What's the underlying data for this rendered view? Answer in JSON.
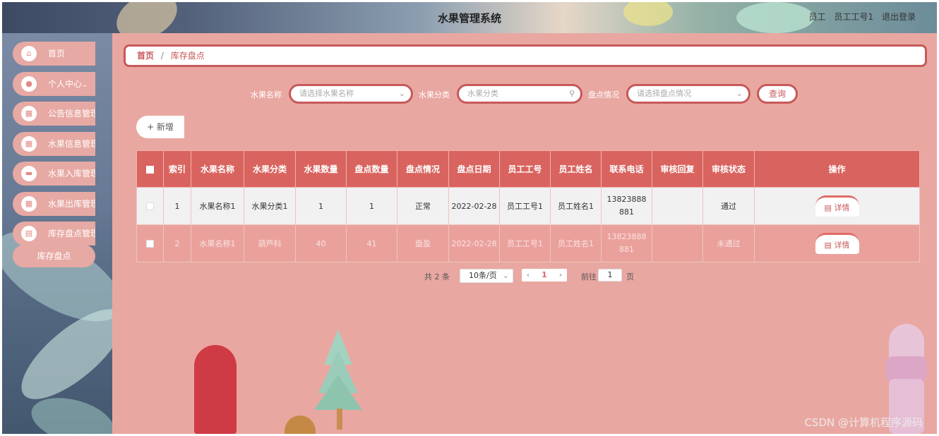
{
  "header": {
    "title": "水果管理系统",
    "role": "员工",
    "user": "员工工号1",
    "logout": "退出登录"
  },
  "sidebar": {
    "items": [
      {
        "label": "首页",
        "icon": "home-icon"
      },
      {
        "label": "个人中心",
        "icon": "user-icon",
        "caret": "⌄"
      },
      {
        "label": "公告信息管理",
        "icon": "grid-icon"
      },
      {
        "label": "水果信息管理",
        "icon": "grid-icon"
      },
      {
        "label": "水果入库管理",
        "icon": "monitor-icon"
      },
      {
        "label": "水果出库管理",
        "icon": "grid-icon"
      },
      {
        "label": "库存盘点管理",
        "icon": "document-icon"
      }
    ],
    "subitem": "库存盘点"
  },
  "breadcrumb": {
    "home": "首页",
    "separator": "/",
    "current": "库存盘点"
  },
  "filters": {
    "name_label": "水果名称",
    "name_placeholder": "请选择水果名称",
    "category_label": "水果分类",
    "category_placeholder": "水果分类",
    "status_label": "盘点情况",
    "status_placeholder": "请选择盘点情况",
    "query_button": "查询"
  },
  "toolbar": {
    "add_button": "+ 新增"
  },
  "table": {
    "headers": [
      "索引",
      "水果名称",
      "水果分类",
      "水果数量",
      "盘点数量",
      "盘点情况",
      "盘点日期",
      "员工工号",
      "员工姓名",
      "联系电话",
      "审核回复",
      "审核状态",
      "操作"
    ],
    "rows": [
      {
        "index": "1",
        "name": "水果名称1",
        "category": "水果分类1",
        "quantity": "1",
        "count": "1",
        "status": "正常",
        "date": "2022-02-28",
        "emp_id": "员工工号1",
        "emp_name": "员工姓名1",
        "phone": "13823888881",
        "reply": "",
        "review": "通过",
        "action": "详情"
      },
      {
        "index": "2",
        "name": "水果名称1",
        "category": "葫芦科",
        "quantity": "40",
        "count": "41",
        "status": "盘盈",
        "date": "2022-02-28",
        "emp_id": "员工工号1",
        "emp_name": "员工姓名1",
        "phone": "13823888881",
        "reply": "",
        "review": "未通过",
        "action": "详情"
      }
    ]
  },
  "pagination": {
    "total": "共 2 条",
    "page_size": "10条/页",
    "current": "1",
    "goto_label": "前往",
    "goto_value": "1",
    "page_suffix": "页"
  },
  "watermark": "CSDN @计算机程序源码",
  "colors": {
    "accent": "#d9645f",
    "background": "#e9a7a1",
    "border": "#c7595a"
  }
}
